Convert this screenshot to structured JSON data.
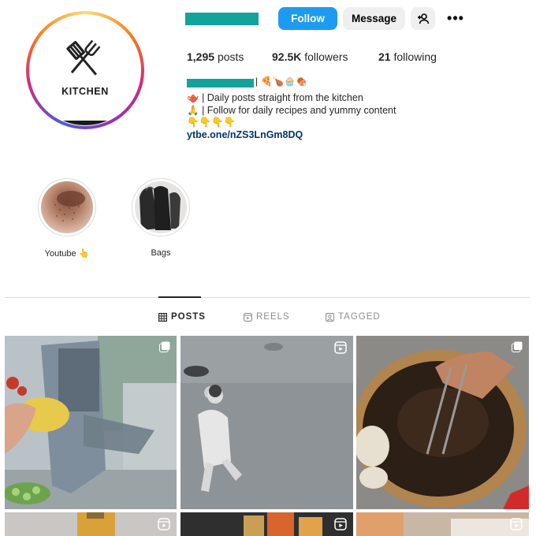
{
  "profile": {
    "avatar_text": "KITCHEN",
    "follow_label": "Follow",
    "message_label": "Message",
    "more_label": "•••"
  },
  "stats": {
    "posts_count": "1,295",
    "posts_label": "posts",
    "followers_count": "92.5K",
    "followers_label": "followers",
    "following_count": "21",
    "following_label": "following"
  },
  "bio": {
    "name_suffix": "|",
    "emojis": "🍕🍗🧁🍖",
    "line1": "| Daily posts straight from the kitchen",
    "line1_icon": "🫖",
    "line2": "| Follow for daily recipes and yummy content",
    "line2_icon": "🙏",
    "line3": "👇👇👇👇",
    "link": "ytbe.one/nZS3LnGm8DQ"
  },
  "highlights": [
    {
      "label": "Youtube 👆"
    },
    {
      "label": "Bags"
    }
  ],
  "tabs": [
    {
      "label": "POSTS",
      "icon": "grid-icon"
    },
    {
      "label": "REELS",
      "icon": "reels-icon"
    },
    {
      "label": "TAGGED",
      "icon": "tag-icon"
    }
  ],
  "posts": [
    {
      "type": "multi",
      "icon": "carousel-icon"
    },
    {
      "type": "reel",
      "icon": "reels-icon"
    },
    {
      "type": "multi",
      "icon": "carousel-icon"
    },
    {
      "type": "reel",
      "icon": "reels-icon"
    },
    {
      "type": "reel",
      "icon": "reels-icon"
    },
    {
      "type": "reel",
      "icon": "reels-icon"
    }
  ],
  "colors": {
    "accent": "#1d9bf0",
    "redaction": "#13a39a",
    "link": "#00376b"
  }
}
